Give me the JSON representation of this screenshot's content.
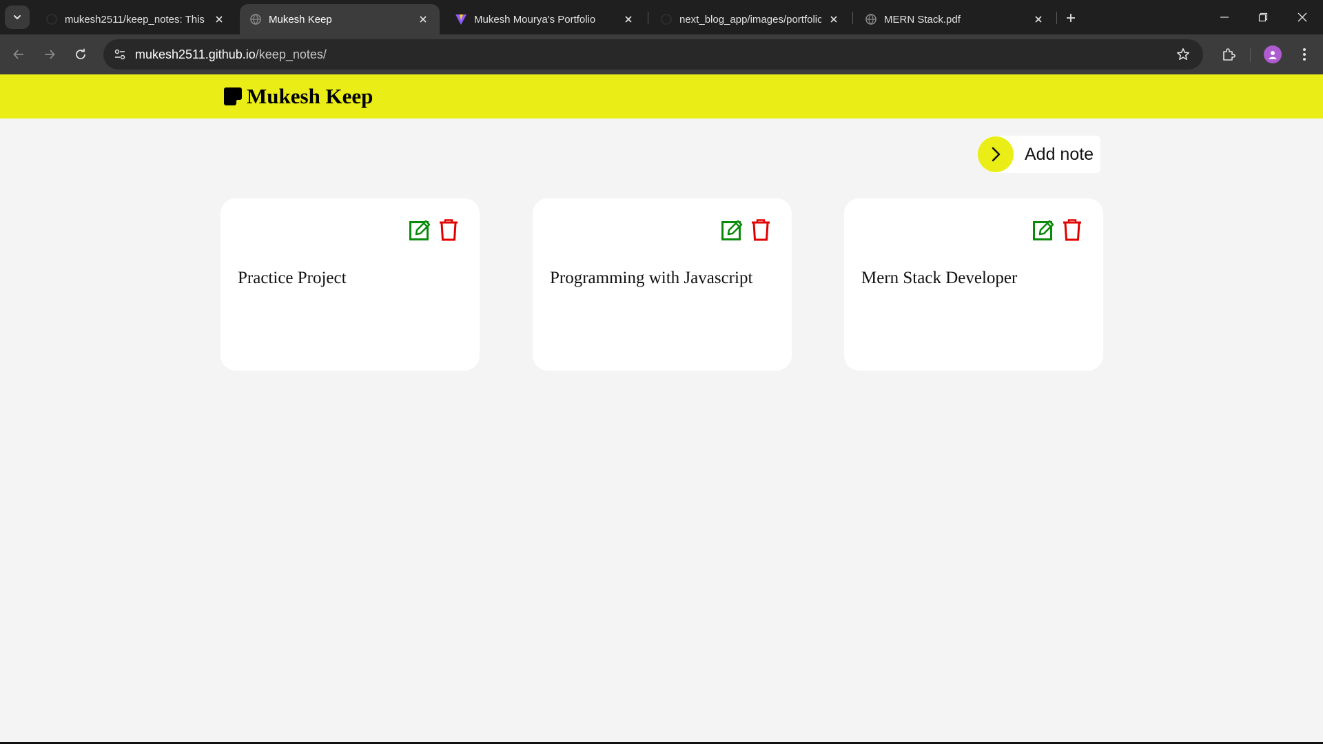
{
  "browser": {
    "tabs": [
      {
        "title": "mukesh2511/keep_notes: This i",
        "favicon": "github-icon",
        "active": false
      },
      {
        "title": "Mukesh Keep",
        "favicon": "globe-icon",
        "active": true
      },
      {
        "title": "Mukesh Mourya's Portfolio",
        "favicon": "vite-icon",
        "active": false
      },
      {
        "title": "next_blog_app/images/portfolic",
        "favicon": "github-icon",
        "active": false
      },
      {
        "title": "MERN Stack.pdf",
        "favicon": "globe-icon",
        "active": false
      }
    ],
    "url_host": "mukesh2511.github.io",
    "url_path": "/keep_notes/"
  },
  "app": {
    "brand": "Mukesh Keep",
    "accent_color": "#ebed17",
    "add_note_label": "Add note",
    "notes": [
      {
        "title": "Practice Project"
      },
      {
        "title": "Programming with Javascript"
      },
      {
        "title": "Mern Stack Developer"
      }
    ],
    "edit_icon_color": "#0a8a0a",
    "delete_icon_color": "#e00000"
  }
}
